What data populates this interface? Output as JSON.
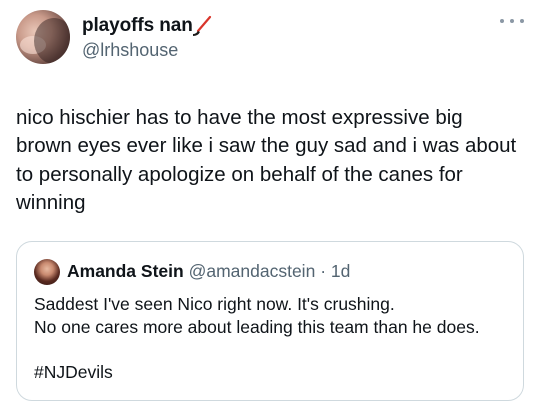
{
  "author": {
    "display_name": "playoffs nan",
    "handle": "@lrhshouse",
    "badge_icon": "hockey-stick-icon",
    "avatar_icon": "profile-photo"
  },
  "tweet": {
    "text": "nico hischier has to have the most expressive big\nbrown eyes ever like i saw the guy sad and i was about\nto personally apologize on behalf of the canes for\nwinning"
  },
  "menu": {
    "icon": "more-options-icon"
  },
  "quoted_tweet": {
    "display_name": "Amanda Stein",
    "handle": "@amandacstein",
    "separator": "·",
    "time": "1d",
    "lines": [
      "Saddest I've seen Nico right now. It's crushing.",
      "No one cares more about leading this team than he does."
    ],
    "hashtag": "#NJDevils"
  },
  "colors": {
    "text_primary": "#0f1419",
    "text_secondary": "#536471",
    "border": "#cfd9de",
    "stick_red": "#d9352b"
  }
}
